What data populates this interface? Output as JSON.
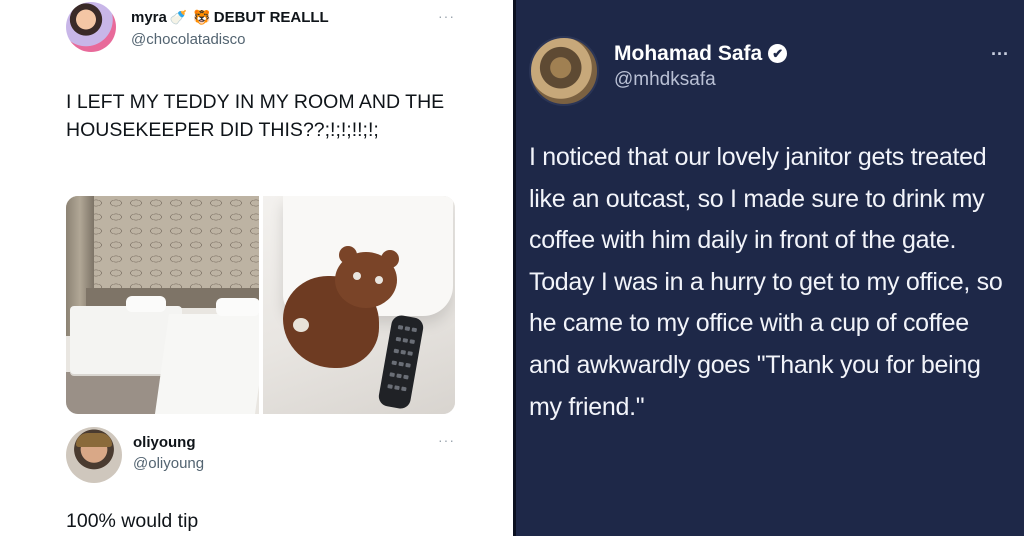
{
  "left_panel": {
    "tweet": {
      "author_name": "myra",
      "author_emojis": [
        "🍼",
        "🐯"
      ],
      "author_suffix": "DEBUT REALLL",
      "author_handle": "@chocolatadisco",
      "more_label": "···",
      "text": "I LEFT MY TEDDY IN MY ROOM AND THE HOUSEKEEPER DID THIS??;!;!;!!;!;",
      "photos": [
        "hotel-room-photo",
        "teddy-bear-photo"
      ]
    },
    "reply": {
      "author_name": "oliyoung",
      "author_handle": "@oliyoung",
      "more_label": "···",
      "text": "100% would tip"
    }
  },
  "right_panel": {
    "tweet": {
      "author_name": "Mohamad Safa",
      "verified_glyph": "✔",
      "author_handle": "@mhdksafa",
      "more_label": "···",
      "text": "I noticed that our lovely janitor gets treated like an outcast, so I made sure to drink my coffee with him daily in front of the gate. Today I was in a hurry to get to my office, so he came to my office with a cup of coffee and awkwardly goes \"Thank you for being my friend.\""
    }
  },
  "colors": {
    "left_background": "#ffffff",
    "right_background": "#1e2848",
    "text_dark": "#0f1419",
    "text_muted": "#536471",
    "text_light": "#f2f4fa"
  }
}
